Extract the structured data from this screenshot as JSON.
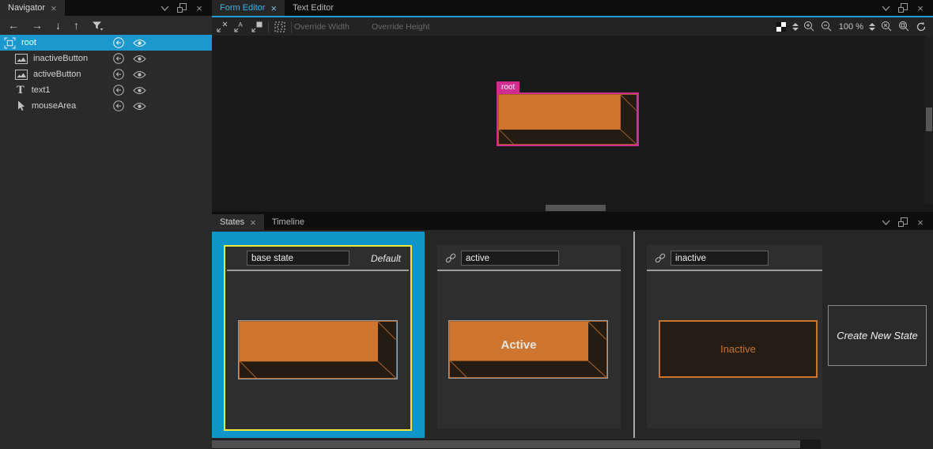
{
  "ui": {
    "close_glyph": "×",
    "arrows": {
      "back": "←",
      "forward": "→",
      "down": "↓",
      "up": "↑"
    }
  },
  "navigator": {
    "title": "Navigator",
    "toolbar_icons": [
      "back-icon",
      "forward-icon",
      "move-down-icon",
      "move-up-icon",
      "filter-icon"
    ],
    "items": [
      {
        "label": "root",
        "icon": "component-icon",
        "selected": true
      },
      {
        "label": "inactiveButton",
        "icon": "image-icon",
        "selected": false
      },
      {
        "label": "activeButton",
        "icon": "image-icon",
        "selected": false
      },
      {
        "label": "text1",
        "icon": "text-icon",
        "glyph": "T",
        "selected": false
      },
      {
        "label": "mouseArea",
        "icon": "mouse-area-icon",
        "selected": false
      }
    ],
    "row_icons": [
      "export-icon",
      "eye-icon"
    ]
  },
  "editor": {
    "tabs": {
      "form": "Form Editor",
      "text": "Text Editor"
    },
    "toolbar": {
      "left_icons": [
        "snapping-off-icon",
        "snapping-anchors-icon",
        "snapping-icon",
        "bounding-rectangles-icon"
      ],
      "override_width_placeholder": "Override Width",
      "override_height_placeholder": "Override Height",
      "right_icons": [
        "canvas-color-icon",
        "zoom-in-icon",
        "zoom-out-icon",
        "zoom-step-icon",
        "zoom-selection-icon",
        "zoom-fit-icon",
        "reset-view-icon"
      ],
      "zoom_level": "100 %"
    },
    "canvas": {
      "selected_item_label": "root"
    }
  },
  "states": {
    "tabs": {
      "states": "States",
      "timeline": "Timeline"
    },
    "base_state": {
      "name": "base state",
      "badge": "Default"
    },
    "active_state": {
      "name": "active",
      "preview_text": "Active"
    },
    "inactive_state": {
      "name": "inactive",
      "preview_text": "Inactive"
    },
    "create_button": "Create New State"
  },
  "colors": {
    "accent_blue": "#1f9cd8",
    "selection_blue": "#1b99cf",
    "state_card_blue": "#1095c8",
    "state_highlight_yellow": "#efe93a",
    "canvas_selection_pink": "#d12c8f",
    "button_orange": "#ce762f",
    "button_outline_orange": "#b06527",
    "inactive_orange": "#c9732c"
  }
}
